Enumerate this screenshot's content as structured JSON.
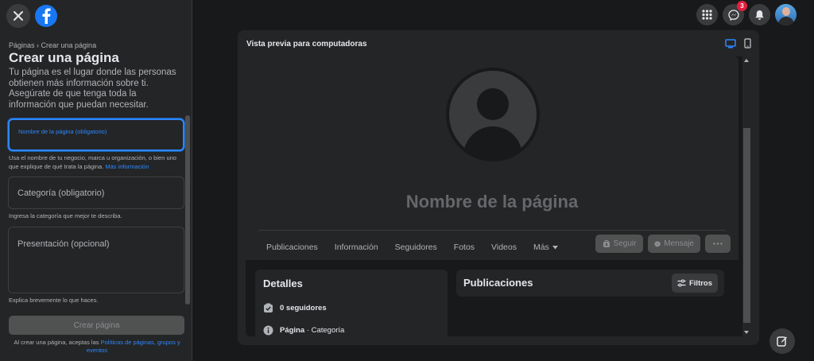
{
  "sidebar": {
    "breadcrumb": "Páginas › Crear una página",
    "title": "Crear una página",
    "intro": "Tu página es el lugar donde las personas obtienen más información sobre ti. Asegúrate de que tenga toda la información que puedan necesitar.",
    "name_field": {
      "label": "Nombre de la página (obligatorio)",
      "help": "Usa el nombre de tu negocio, marca u organización, o bien uno que explique de qué trata la página.",
      "help_link": "Más información"
    },
    "category_field": {
      "label": "Categoría (obligatorio)",
      "help": "Ingresa la categoría que mejor te describa."
    },
    "bio_field": {
      "label": "Presentación (opcional)",
      "help": "Explica brevemente lo que haces."
    },
    "create_button": "Crear página",
    "terms_prefix": "Al crear una página, aceptas las",
    "terms_link": "Políticas de páginas, grupos y eventos"
  },
  "topbar": {
    "messenger_badge": "3"
  },
  "preview": {
    "title": "Vista previa para computadoras",
    "page_name": "Nombre de la página",
    "nav": [
      "Publicaciones",
      "Información",
      "Seguidores",
      "Fotos",
      "Videos",
      "Más"
    ],
    "follow_button": "Seguir",
    "message_button": "Mensaje",
    "details_title": "Detalles",
    "followers": "0 seguidores",
    "page_label": "Página",
    "category_label": "Categoría",
    "posts_title": "Publicaciones",
    "filters_button": "Filtros"
  },
  "colors": {
    "accent": "#2d88ff",
    "brand": "#1877f2",
    "badge": "#e41e3f"
  }
}
